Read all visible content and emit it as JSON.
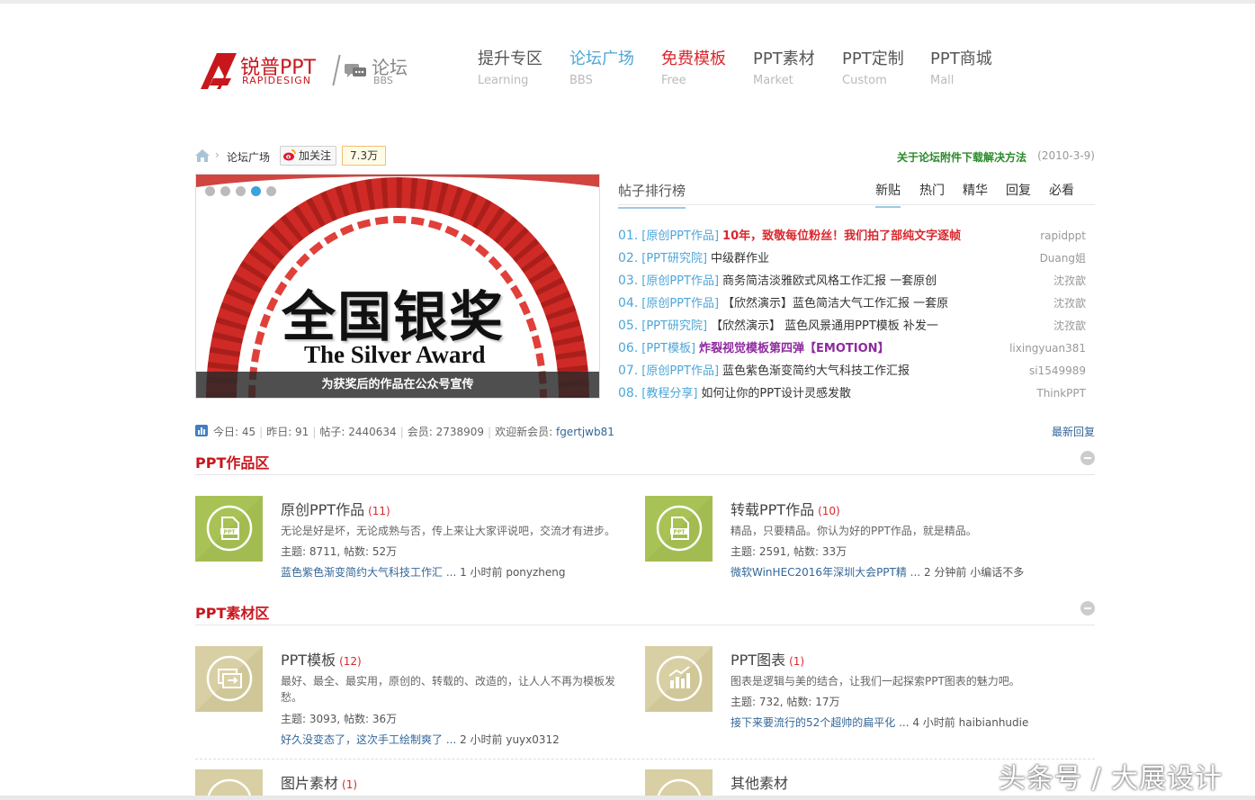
{
  "logo": {
    "cn": "锐普PPT",
    "en": "RAPIDESIGN",
    "bbs": "论坛",
    "bbs_en": "BBS"
  },
  "nav": [
    {
      "cn": "提升专区",
      "en": "Learning"
    },
    {
      "cn": "论坛广场",
      "en": "BBS"
    },
    {
      "cn": "免费模板",
      "en": "Free"
    },
    {
      "cn": "PPT素材",
      "en": "Market"
    },
    {
      "cn": "PPT定制",
      "en": "Custom"
    },
    {
      "cn": "PPT商城",
      "en": "Mall"
    }
  ],
  "crumb": {
    "sep": "›",
    "current": "论坛广场",
    "follow": "加关注",
    "count": "7.3万",
    "notice": "关于论坛附件下载解决方法",
    "notice_date": "(2010-3-9)"
  },
  "slider": {
    "title": "全国银奖",
    "subtitle": "The Silver Award",
    "caption": "为获奖后的作品在公众号宣传",
    "active_dot": 4
  },
  "rank": {
    "title": "帖子排行榜",
    "tabs": [
      "新贴",
      "热门",
      "精华",
      "回复",
      "必看"
    ],
    "items": [
      {
        "num": "01.",
        "cat": "[原创PPT作品]",
        "title": "10年，致敬每位粉丝！我们拍了部纯文字逐帧",
        "user": "rapidppt"
      },
      {
        "num": "02.",
        "cat": "[PPT研究院]",
        "title": "中级群作业",
        "user": "Duang姐"
      },
      {
        "num": "03.",
        "cat": "[原创PPT作品]",
        "title": "商务简洁淡雅欧式风格工作汇报 一套原创",
        "user": "沈孜歆"
      },
      {
        "num": "04.",
        "cat": "[原创PPT作品]",
        "title": "【欣然演示】蓝色简洁大气工作汇报 一套原",
        "user": "沈孜歆"
      },
      {
        "num": "05.",
        "cat": "[PPT研究院]",
        "title": "【欣然演示】 蓝色风景通用PPT模板 补发一",
        "user": "沈孜歆"
      },
      {
        "num": "06.",
        "cat": "[PPT模板]",
        "title": "炸裂视觉模板第四弹【EMOTION】",
        "user": "lixingyuan381"
      },
      {
        "num": "07.",
        "cat": "[原创PPT作品]",
        "title": "蓝色紫色渐变简约大气科技工作汇报",
        "user": "si1549989"
      },
      {
        "num": "08.",
        "cat": "[教程分享]",
        "title": "如何让你的PPT设计灵感发散",
        "user": "ThinkPPT"
      }
    ]
  },
  "stats": {
    "today": "今日: 45",
    "yesterday": "昨日: 91",
    "posts": "帖子: 2440634",
    "members": "会员: 2738909",
    "welcome": "欢迎新会员:",
    "new_member": "fgertjwb81",
    "latest": "最新回复"
  },
  "sections": [
    {
      "title": "PPT作品区",
      "forums": [
        {
          "name": "原创PPT作品",
          "count": "(11)",
          "desc": "无论是好是坏，无论成熟与否，传上来让大家评说吧，交流才有进步。",
          "stat": "主题: 8711, 帖数: 52万",
          "last_title": "蓝色紫色渐变简约大气科技工作汇 ...",
          "last_info": " 1 小时前 ponyzheng",
          "icon": "ppt-file-icon"
        },
        {
          "name": "转载PPT作品",
          "count": "(10)",
          "desc": "精品，只要精品。你认为好的PPT作品，就是精品。",
          "stat": "主题: 2591, 帖数: 33万",
          "last_title": "微软WinHEC2016年深圳大会PPT精 ...",
          "last_info": " 2 分钟前 小编话不多",
          "icon": "ppt-file-icon"
        }
      ]
    },
    {
      "title": "PPT素材区",
      "forums": [
        {
          "name": "PPT模板",
          "count": "(12)",
          "desc": "最好、最全、最实用，原创的、转载的、改造的，让人人不再为模板发愁。",
          "stat": "主题: 3093, 帖数: 36万",
          "last_title": "好久没变态了，这次手工绘制爽了 ...",
          "last_info": " 2 小时前 yuyx0312",
          "icon": "template-icon"
        },
        {
          "name": "PPT图表",
          "count": "(1)",
          "desc": "图表是逻辑与美的结合，让我们一起探索PPT图表的魅力吧。",
          "stat": "主题: 732, 帖数: 17万",
          "last_title": "接下来要流行的52个超帅的扁平化 ...",
          "last_info": " 4 小时前 haibianhudie",
          "icon": "chart-icon"
        },
        {
          "name": "图片素材",
          "count": "(1)",
          "icon": "image-icon"
        },
        {
          "name": "其他素材",
          "count": "",
          "icon": "other-icon"
        }
      ]
    }
  ],
  "watermark": "头条号 / 大展设计",
  "colors": {
    "brand": "#c8161d",
    "accent": "#4da6d8",
    "green_icon": "#a8c256",
    "tan_icon": "#d8cfa4"
  }
}
